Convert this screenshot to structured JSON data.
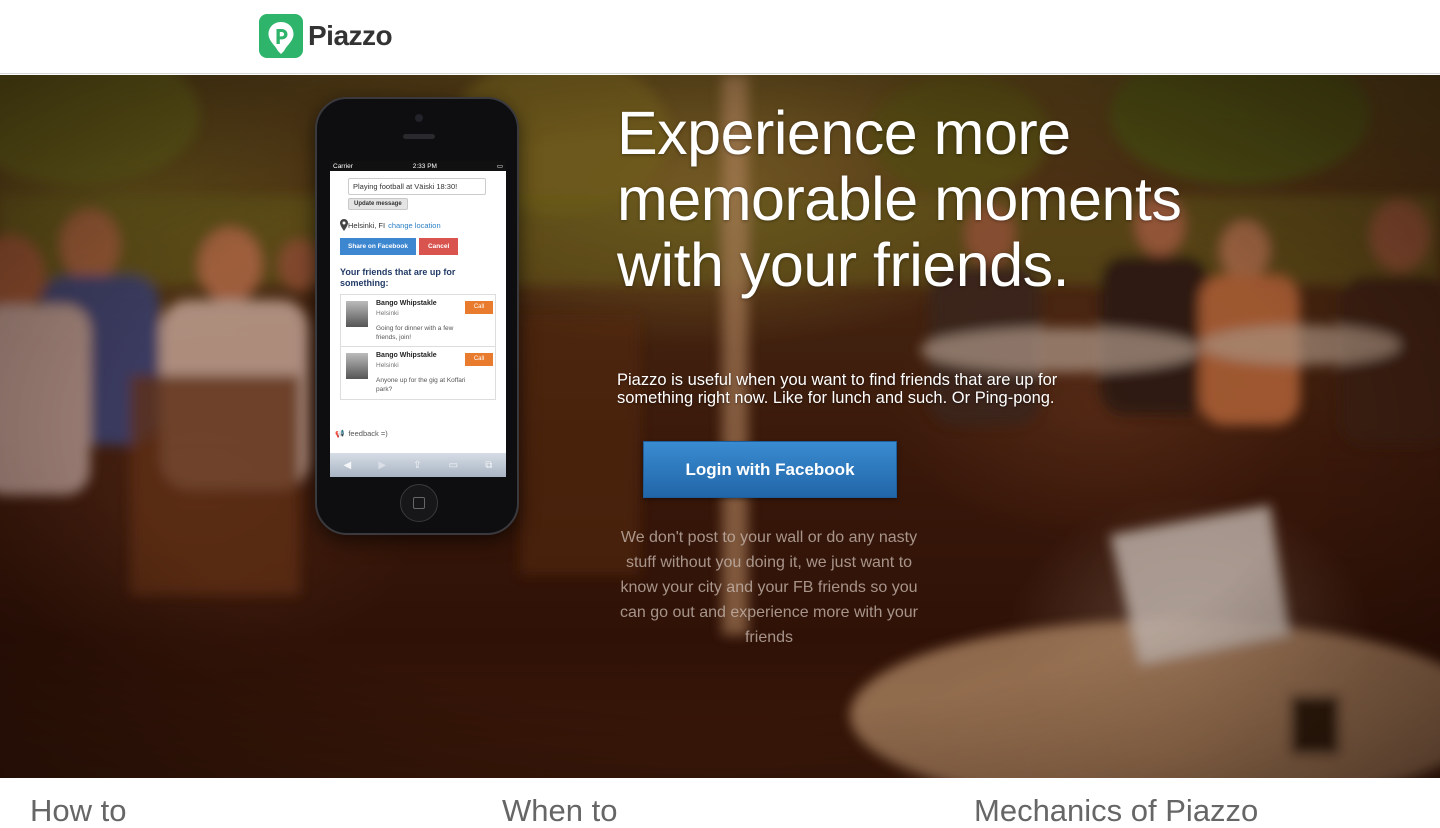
{
  "header": {
    "logo_text": "Piazzo"
  },
  "phone_screen": {
    "status": {
      "carrier": "Carrier",
      "time": "2:33 PM"
    },
    "message_value": "Playing football at Väiski 18:30!",
    "update_button": "Update message",
    "location": {
      "city": "Helsinki, FI",
      "change_link": "change location"
    },
    "share_button": "Share on Facebook",
    "cancel_button": "Cancel",
    "friends_heading": "Your friends that are up for something:",
    "friends": [
      {
        "name": "Bango Whipstakle",
        "city": "Helsinki",
        "message": "Going for dinner with a few friends, join!",
        "call": "Call"
      },
      {
        "name": "Bango Whipstakle",
        "city": "Helsinki",
        "message": "Anyone up for the gig at Koffari park?",
        "call": "Call"
      }
    ],
    "feedback": "feedback =)"
  },
  "hero": {
    "headline": "Experience more memorable moments with your friends.",
    "subline": "Piazzo is useful when you want to find friends that are up for something right now. Like for lunch and such. Or Ping-pong.",
    "login_button": "Login with Facebook",
    "disclaimer": "We don't post to your wall or do any nasty stuff without you doing it, we just want to know your city and your FB friends so you can go out and experience more with your friends"
  },
  "sections": {
    "how": "How to",
    "when": "When to",
    "mechanics": "Mechanics of Piazzo"
  },
  "colors": {
    "brand_green": "#2fb46b",
    "facebook_blue": "#2b78c0",
    "cancel_red": "#d9534f",
    "call_orange": "#e87b2e"
  }
}
